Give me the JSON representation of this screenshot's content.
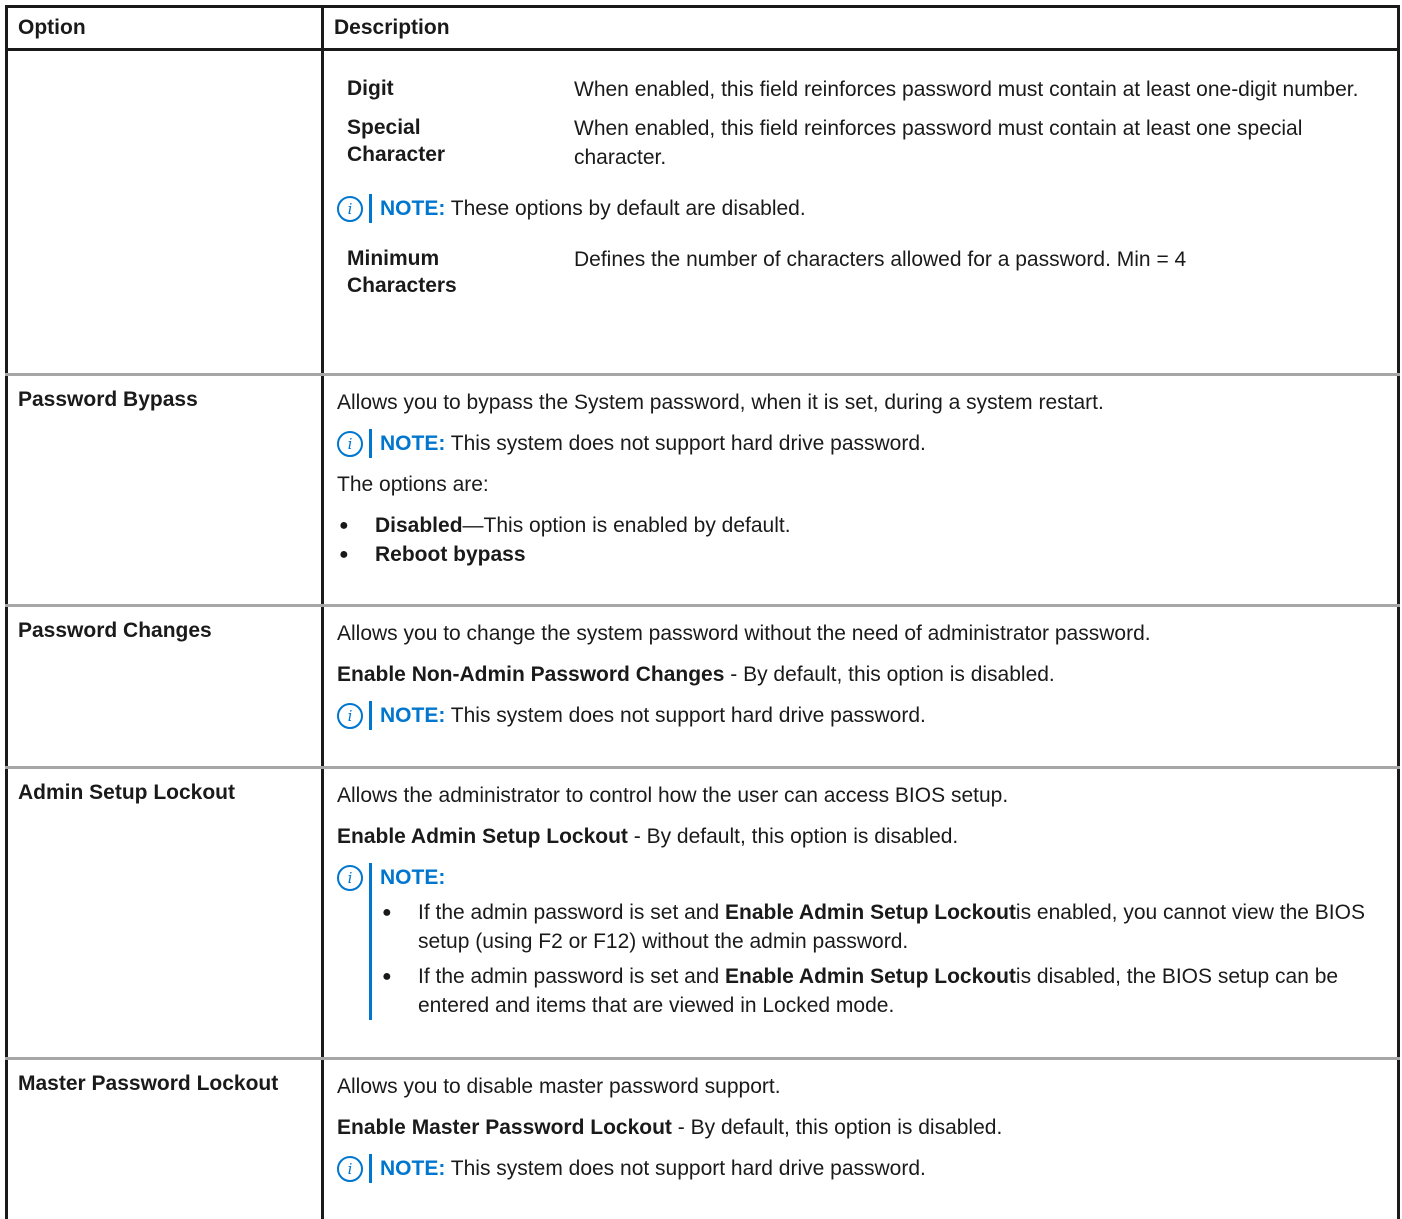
{
  "headers": {
    "option": "Option",
    "description": "Description"
  },
  "row0": {
    "defs": [
      {
        "term": "Digit",
        "desc": "When enabled, this field reinforces password must contain at least one-digit number."
      },
      {
        "term": "Special Character",
        "desc": "When enabled, this field reinforces password must contain at least one special character."
      }
    ],
    "note_kw": "NOTE:",
    "note_text": "These options by default are disabled.",
    "defs2": [
      {
        "term": "Minimum Characters",
        "desc": "Defines the number of characters allowed for a password. Min = 4"
      }
    ]
  },
  "row1": {
    "option": "Password Bypass",
    "desc": "Allows you to bypass the System password, when it is set, during a system restart.",
    "note_kw": "NOTE:",
    "note_text": "This system does not support hard drive password.",
    "options_intro": "The options are:",
    "bullet1_bold": "Disabled",
    "bullet1_rest": "—This option is enabled by default.",
    "bullet2_bold": "Reboot bypass"
  },
  "row2": {
    "option": "Password Changes",
    "desc": "Allows you to change the system password without the need of administrator password.",
    "setting_bold": "Enable Non-Admin Password Changes",
    "setting_rest": " - By default, this option is disabled.",
    "note_kw": "NOTE:",
    "note_text": "This system does not support hard drive password."
  },
  "row3": {
    "option": "Admin Setup Lockout",
    "desc": "Allows the administrator to control how the user can access BIOS setup.",
    "setting_bold": "Enable Admin Setup Lockout",
    "setting_rest": " - By default, this option is disabled.",
    "note_kw": "NOTE:",
    "b1_pre": "If the admin password is set and ",
    "b1_bold": "Enable Admin Setup Lockout",
    "b1_post": "is enabled, you cannot view the BIOS setup (using F2 or F12) without the admin password.",
    "b2_pre": "If the admin password is set and ",
    "b2_bold": "Enable Admin Setup Lockout",
    "b2_post": "is disabled, the BIOS setup can be entered and items that are viewed in Locked mode."
  },
  "row4": {
    "option": "Master Password Lockout",
    "desc": "Allows you to disable master password support.",
    "setting_bold": "Enable Master Password Lockout",
    "setting_rest": " - By default, this option is disabled.",
    "note_kw": "NOTE:",
    "note_text": "This system does not support hard drive password."
  },
  "colors": {
    "note_accent": "#0076ce",
    "text": "#1a1a1a",
    "row_divider": "#a6a6a6"
  },
  "icons": {
    "note": "info-circle-icon",
    "bullet": "bullet-icon"
  }
}
